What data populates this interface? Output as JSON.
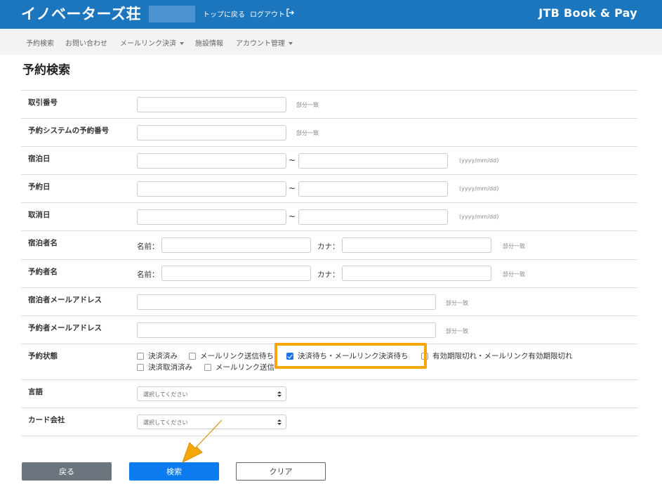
{
  "header": {
    "brand": "イノベーターズ荘",
    "top_link": "トップに戻る",
    "logout_link": "ログアウト",
    "provider": "JTB Book & Pay"
  },
  "nav": {
    "reservation_search": "予約検索",
    "contact": "お問い合わせ",
    "mail_link_payment": "メールリンク決済",
    "facility_info": "施設情報",
    "account_management": "アカウント管理"
  },
  "page": {
    "title": "予約検索"
  },
  "form": {
    "transaction_number": {
      "label": "取引番号",
      "hint": "部分一致",
      "value": ""
    },
    "system_reservation_number": {
      "label": "予約システムの予約番号",
      "hint": "部分一致",
      "value": ""
    },
    "stay_date": {
      "label": "宿泊日",
      "from": "",
      "to": "",
      "hint": "(yyyy/mm/dd)"
    },
    "reservation_date": {
      "label": "予約日",
      "from": "",
      "to": "",
      "hint": "(yyyy/mm/dd)"
    },
    "cancel_date": {
      "label": "取消日",
      "from": "",
      "to": "",
      "hint": "(yyyy/mm/dd)"
    },
    "range_separator": "~",
    "guest_name": {
      "label": "宿泊者名",
      "name_label": "名前：",
      "kana_label": "カナ：",
      "hint": "部分一致"
    },
    "booker_name": {
      "label": "予約者名",
      "name_label": "名前：",
      "kana_label": "カナ：",
      "hint": "部分一致"
    },
    "guest_email": {
      "label": "宿泊者メールアドレス",
      "hint": "部分一致"
    },
    "booker_email": {
      "label": "予約者メールアドレス",
      "hint": "部分一致"
    },
    "status": {
      "label": "予約状態",
      "options": [
        {
          "label": "決済済み",
          "checked": false
        },
        {
          "label": "メールリンク送信待ち",
          "checked": false
        },
        {
          "label": "決済待ち・メールリンク決済待ち",
          "checked": true
        },
        {
          "label": "有効期限切れ・メールリンク有効期限切れ",
          "checked": false
        },
        {
          "label": "決済取消済み",
          "checked": false
        },
        {
          "label": "メールリンク送信",
          "checked": false
        }
      ]
    },
    "language": {
      "label": "言語",
      "selected": "選択してください"
    },
    "card_company": {
      "label": "カード会社",
      "selected": "選択してください"
    }
  },
  "buttons": {
    "back": "戻る",
    "search": "検索",
    "clear": "クリア"
  },
  "colors": {
    "header_bg": "#1b76be",
    "primary": "#0d7bf0",
    "secondary": "#6c757d",
    "highlight": "#f5a70a"
  }
}
